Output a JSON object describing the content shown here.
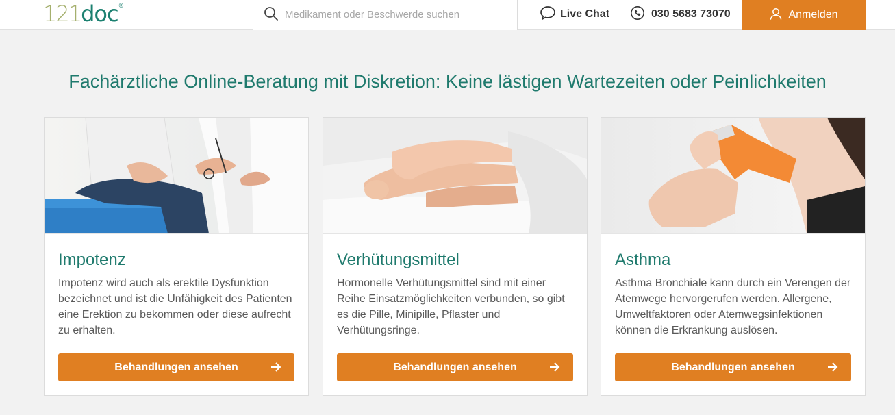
{
  "header": {
    "logo": {
      "number": "121",
      "word": "doc",
      "reg": "®"
    },
    "search": {
      "placeholder": "Medikament oder Beschwerde suchen",
      "value": ""
    },
    "live_chat": "Live Chat",
    "phone": "030 5683 73070",
    "login": "Anmelden"
  },
  "headline": "Fachärztliche Online-Beratung mit Diskretion: Keine lästigen Wartezeiten oder Peinlichkeiten",
  "cards": [
    {
      "title": "Impotenz",
      "description": "Impotenz wird auch als erektile Dysfunktion bezeichnet und ist die Unfähigkeit des Patienten eine Erektion zu bekommen oder diese aufrecht zu erhalten.",
      "button": "Behandlungen ansehen"
    },
    {
      "title": "Verhütungsmittel",
      "description": "Hormonelle Verhütungsmittel sind mit einer Reihe Einsatzmöglichkeiten verbunden, so gibt es die Pille, Minipille, Pflaster und Verhütungsringe.",
      "button": "Behandlungen ansehen"
    },
    {
      "title": "Asthma",
      "description": "Asthma Bronchiale kann durch ein Verengen der Atemwege hervorgerufen werden. Allergene, Umweltfaktoren oder Atemwegsinfektionen können die Erkrankung auslösen.",
      "button": "Behandlungen ansehen"
    }
  ],
  "colors": {
    "accent": "#e07f22",
    "brand_teal": "#1f7a6d",
    "logo_olive": "#a5b06e"
  },
  "icons": [
    "search-icon",
    "chat-bubble-icon",
    "phone-icon",
    "user-icon",
    "arrow-right-icon"
  ]
}
